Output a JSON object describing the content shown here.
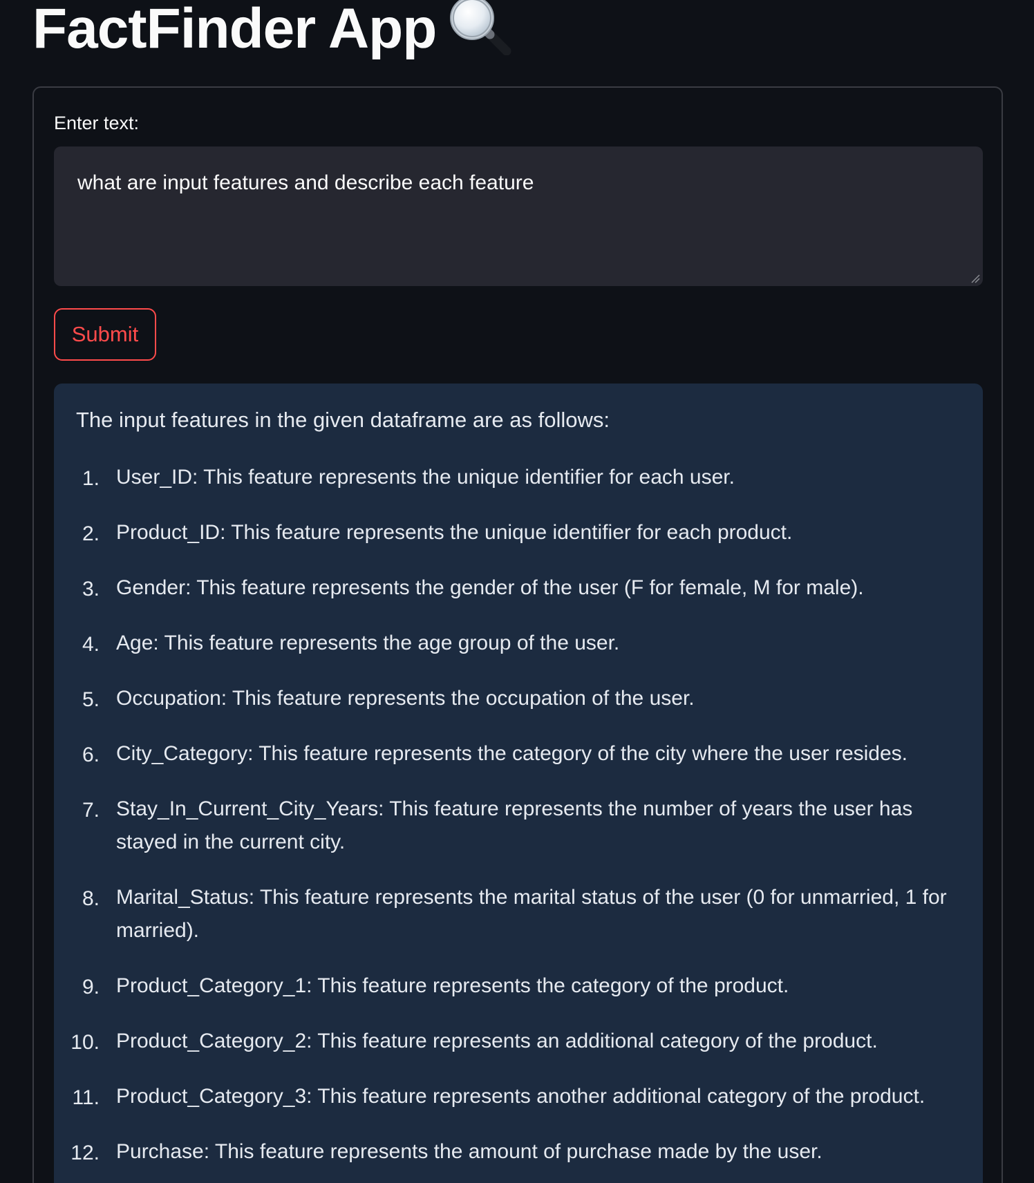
{
  "app": {
    "title": "FactFinder App",
    "title_icon": "magnifying-glass-icon"
  },
  "form": {
    "input_label": "Enter text:",
    "input_value": "what are input features and describe each feature",
    "submit_label": "Submit"
  },
  "answer": {
    "intro": "The input features in the given dataframe are as follows:",
    "items": [
      {
        "num": "1.",
        "lines": [
          "User_ID: This feature represents the unique identifier for each user."
        ]
      },
      {
        "num": "2.",
        "lines": [
          "Product_ID: This feature represents the unique identifier for each product."
        ]
      },
      {
        "num": "3.",
        "lines": [
          "Gender: This feature represents the gender of the user (F for female, M for male)."
        ]
      },
      {
        "num": "4.",
        "lines": [
          "Age: This feature represents the age group of the user."
        ]
      },
      {
        "num": "5.",
        "lines": [
          "Occupation: This feature represents the occupation of the user."
        ]
      },
      {
        "num": "6.",
        "lines": [
          "City_Category: This feature represents the category of the city where the user resides."
        ]
      },
      {
        "num": "7.",
        "lines": [
          "Stay_In_Current_City_Years: This feature represents the number of years the user has",
          "stayed in the current city."
        ]
      },
      {
        "num": "8.",
        "lines": [
          "Marital_Status: This feature represents the marital status of the user (0 for unmarried, 1 for",
          "married)."
        ]
      },
      {
        "num": "9.",
        "lines": [
          "Product_Category_1: This feature represents the category of the product."
        ]
      },
      {
        "num": "10.",
        "lines": [
          "Product_Category_2: This feature represents an additional category of the product."
        ]
      },
      {
        "num": "11.",
        "lines": [
          "Product_Category_3: This feature represents another additional category of the product."
        ]
      },
      {
        "num": "12.",
        "lines": [
          "Purchase: This feature represents the amount of purchase made by the user."
        ]
      }
    ]
  },
  "colors": {
    "background": "#0e1117",
    "accent": "#ff4b4b",
    "answer_bg": "#1c2b40",
    "input_bg": "#262730"
  }
}
